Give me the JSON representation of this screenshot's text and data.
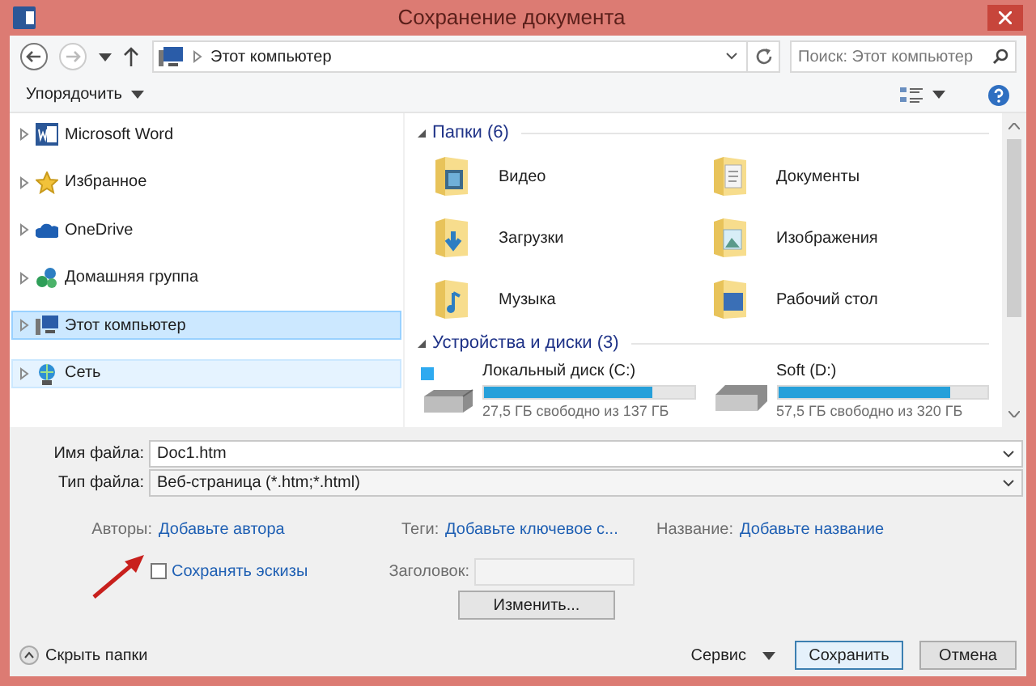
{
  "window": {
    "title": "Сохранение документа"
  },
  "address": {
    "path": "Этот компьютер"
  },
  "search": {
    "placeholder": "Поиск: Этот компьютер"
  },
  "toolbar": {
    "organize": "Упорядочить"
  },
  "sidebar": {
    "items": [
      {
        "label": "Microsoft Word",
        "kind": "word",
        "selected": false,
        "hovered": false
      },
      {
        "label": "Избранное",
        "kind": "favorites",
        "selected": false,
        "hovered": false
      },
      {
        "label": "OneDrive",
        "kind": "cloud",
        "selected": false,
        "hovered": false
      },
      {
        "label": "Домашняя группа",
        "kind": "homegroup",
        "selected": false,
        "hovered": false
      },
      {
        "label": "Этот компьютер",
        "kind": "computer",
        "selected": true,
        "hovered": false
      },
      {
        "label": "Сеть",
        "kind": "network",
        "selected": false,
        "hovered": true
      }
    ]
  },
  "folders": {
    "heading": "Папки (6)",
    "items": [
      {
        "label": "Видео",
        "kind": "video"
      },
      {
        "label": "Документы",
        "kind": "documents"
      },
      {
        "label": "Загрузки",
        "kind": "downloads"
      },
      {
        "label": "Изображения",
        "kind": "pictures"
      },
      {
        "label": "Музыка",
        "kind": "music"
      },
      {
        "label": "Рабочий стол",
        "kind": "desktop"
      }
    ]
  },
  "drives": {
    "heading": "Устройства и диски (3)",
    "items": [
      {
        "label": "Локальный диск (C:)",
        "kind": "system",
        "level": 0.8,
        "free": "27,5 ГБ свободно из 137 ГБ"
      },
      {
        "label": "Soft (D:)",
        "kind": "disk",
        "level": 0.82,
        "free": "57,5 ГБ свободно из 320 ГБ"
      }
    ]
  },
  "form": {
    "filename_label": "Имя файла:",
    "filename": "Doc1.htm",
    "filetype_label": "Тип файла:",
    "filetype": "Веб-страница (*.htm;*.html)",
    "meta": [
      {
        "label": "Авторы:",
        "value": "Добавьте автора"
      },
      {
        "label": "Теги:",
        "value": "Добавьте ключевое с..."
      },
      {
        "label": "Название:",
        "value": "Добавьте название"
      }
    ],
    "thumbnails": {
      "label": "Сохранять эскизы",
      "checked": false
    },
    "heading_label": "Заголовок:",
    "change_button": "Изменить..."
  },
  "footer": {
    "hide_folders": "Скрыть папки",
    "tools": "Сервис",
    "save": "Сохранить",
    "cancel": "Отмена"
  }
}
